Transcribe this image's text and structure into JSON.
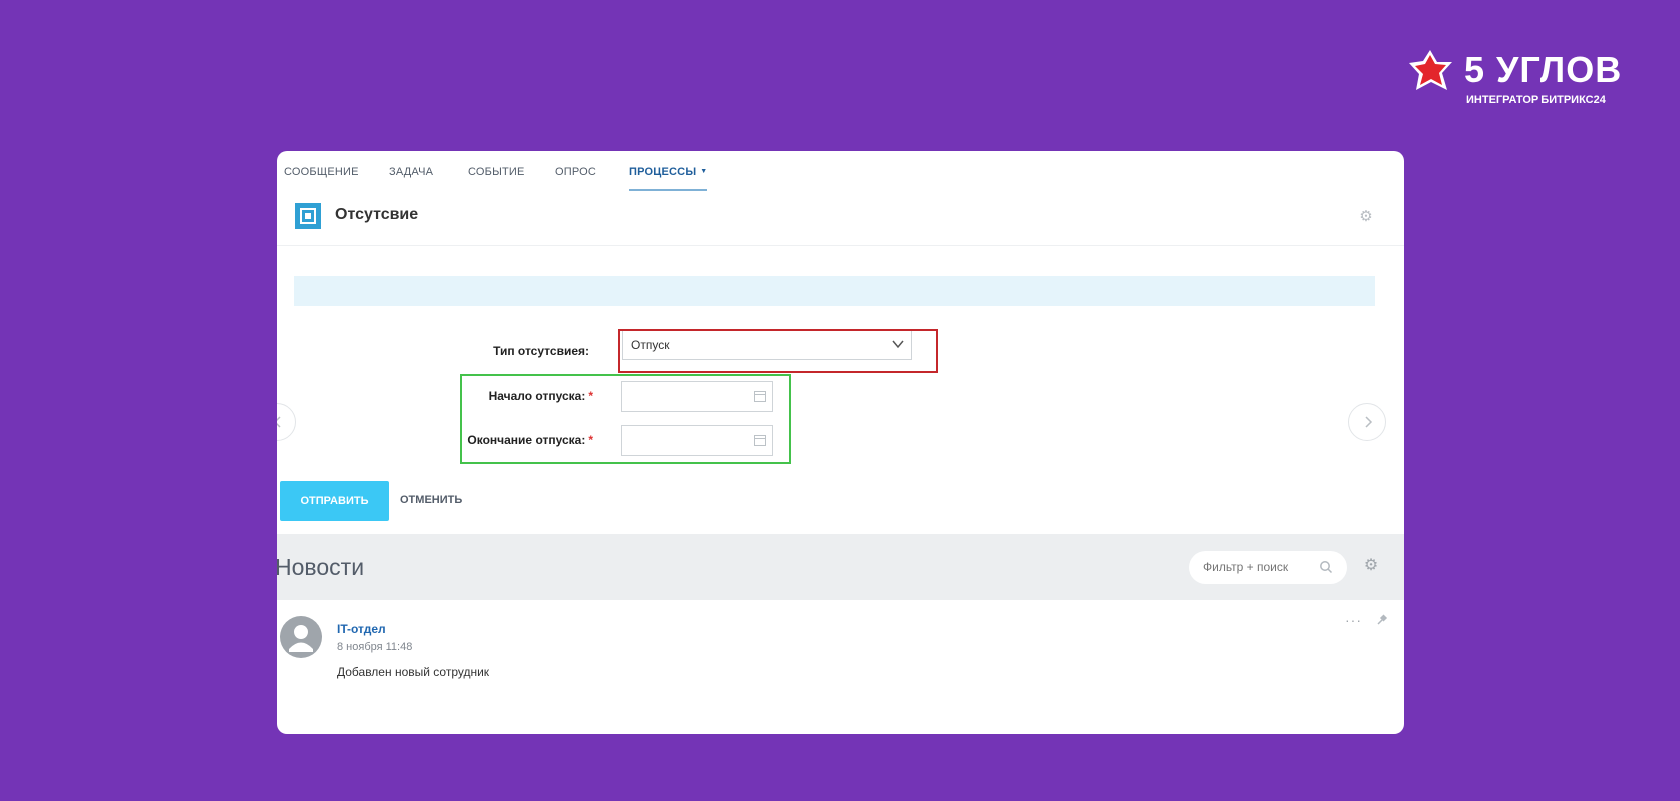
{
  "brand": {
    "name": "5 УГЛОВ",
    "tagline": "ИНТЕГРАТОР БИТРИКС24"
  },
  "tabs": [
    {
      "label": "СООБЩЕНИЕ"
    },
    {
      "label": "ЗАДАЧА"
    },
    {
      "label": "СОБЫТИЕ"
    },
    {
      "label": "ОПРОС"
    },
    {
      "label": "ПРОЦЕССЫ",
      "active": true
    }
  ],
  "process": {
    "title": "Отсутсвие"
  },
  "form": {
    "absence_type_label": "Тип отсутсвиея:",
    "absence_type_value": "Отпуск",
    "start_label": "Начало отпуска:",
    "end_label": "Окончание отпуска:",
    "required_mark": "*",
    "start_value": "",
    "end_value": ""
  },
  "actions": {
    "send_label": "ОТПРАВИТЬ",
    "cancel_label": "ОТМЕНИТЬ"
  },
  "news": {
    "title": "Новости",
    "search_placeholder": "Фильтр + поиск"
  },
  "post": {
    "author": "IT-отдел",
    "date": "8 ноября 11:48",
    "text": "Добавлен новый сотрудник",
    "more": "···"
  },
  "colors": {
    "background": "#7434b6",
    "accent": "#3bc8f5",
    "highlight_red": "#c4272b",
    "highlight_green": "#44c24b"
  }
}
